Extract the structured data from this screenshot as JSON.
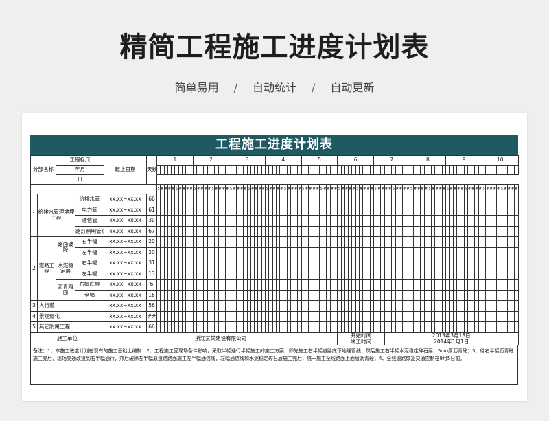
{
  "page": {
    "title": "精简工程施工进度计划表",
    "tags": [
      "简单易用",
      "自动统计",
      "自动更新"
    ],
    "separator": "/"
  },
  "sheet": {
    "title": "工程施工进度计划表",
    "header": {
      "category_label": "分部名称",
      "ruler_label": "工程标尺",
      "month_label": "年月",
      "day_label": "日",
      "start_date_label": "起止日期",
      "days_label": "天数",
      "ruler_numbers": [
        "1",
        "2",
        "3",
        "4",
        "5",
        "6",
        "7",
        "8",
        "9",
        "10"
      ],
      "day_markers": [
        "5",
        "#",
        "#",
        "#",
        "#"
      ]
    },
    "groups": [
      {
        "no": "1",
        "name": "给排水管理地埋工程",
        "rows": [
          {
            "sub": "",
            "item": "给排水管",
            "dates": "xx.xx~xx.xx",
            "days": "66"
          },
          {
            "sub": "",
            "item": "电力管",
            "dates": "xx.xx~xx.xx",
            "days": "61"
          },
          {
            "sub": "",
            "item": "通信管",
            "dates": "xx.xx~xx.xx",
            "days": "30"
          },
          {
            "sub": "",
            "item": "路灯照明管线",
            "dates": "xx.xx~xx.xx",
            "days": "67"
          }
        ]
      },
      {
        "no": "2",
        "name": "道路工程",
        "subgroups": [
          {
            "sub": "路面破除",
            "rows": [
              {
                "item": "右半幅",
                "dates": "xx.xx~xx.xx",
                "days": "20"
              },
              {
                "item": "左半幅",
                "dates": "xx.xx~xx.xx",
                "days": "20"
              }
            ]
          },
          {
            "sub": "水泥稳定层",
            "rows": [
              {
                "item": "右半幅",
                "dates": "xx.xx~xx.xx",
                "days": "31"
              },
              {
                "item": "左半幅",
                "dates": "xx.xx~xx.xx",
                "days": "13"
              }
            ]
          },
          {
            "sub": "沥青路面",
            "rows": [
              {
                "item": "右幅底层",
                "dates": "xx.xx~xx.xx",
                "days": "6"
              },
              {
                "item": "全幅",
                "dates": "xx.xx~xx.xx",
                "days": "16"
              }
            ]
          }
        ]
      },
      {
        "no": "3",
        "name": "人行道",
        "dates": "xx.xx~xx.xx",
        "days": "56"
      },
      {
        "no": "4",
        "name": "景观绿化",
        "dates": "xx.xx~xx.xx",
        "days": "##"
      },
      {
        "no": "5",
        "name": "其它附属工程",
        "dates": "xx.xx~xx.xx",
        "days": "66"
      }
    ],
    "footer": {
      "unit_label": "施工单位",
      "unit_value": "浙江某某建设有限公司",
      "start_label": "开始时间",
      "start_value": "2013年3月18日",
      "end_label": "竣工时间",
      "end_value": "2014年1月1日"
    },
    "notes": "备注：1、本施工进度计划在现有的施工基础上编制　2、工程施工受现场条件影响，采取半幅通行半幅施工的施工方案，即先施工右半幅道路底下地埋管线，然后施工右半幅水泥稳定碎石层，5cm厚沥青砼；3、待右半幅沥青砼施工完后，现场交通改道到右半幅通行，然后破除左半幅原道路路面施工左半幅通信线，左幅通信线和水泥稳定碎石层施工完后，统一施工全线路面上面层沥青砼；4、全线道路恢复交通控制在9月5日前。"
  }
}
